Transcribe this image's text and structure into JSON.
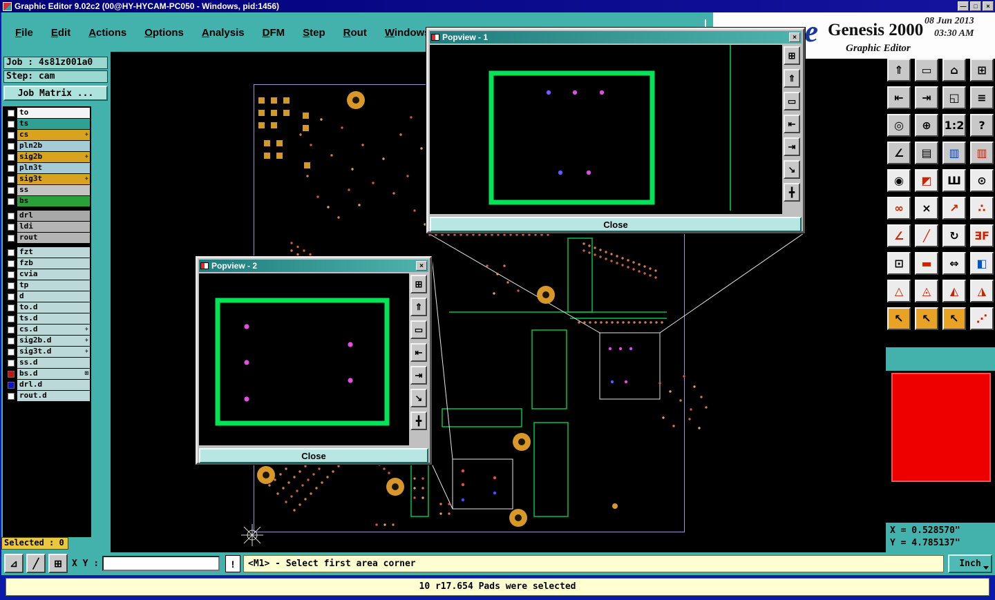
{
  "title_bar": {
    "title": "Graphic Editor 9.02c2 (00@HY-HYCAM-PC050 - Windows, pid:1456)",
    "minimize": "—",
    "maximize": "□",
    "close": "×"
  },
  "menu": {
    "items": [
      "File",
      "Edit",
      "Actions",
      "Options",
      "Analysis",
      "DFM",
      "Step",
      "Rout",
      "Windows"
    ]
  },
  "logo": {
    "partial": "ne",
    "brand": "Genesis 2000",
    "date": "08 Jun 2013",
    "time": "03:30 AM",
    "subtitle": "Graphic Editor"
  },
  "sidebar": {
    "job_label": "Job :",
    "job_value": "4s81z001a0",
    "step_label": "Step:",
    "step_value": "cam",
    "job_matrix_label": "Job Matrix ...",
    "selected_label": "Selected : 0",
    "layer_groups": {
      "main": [
        {
          "name": "to",
          "bg": "#f4f4f4"
        },
        {
          "name": "ts",
          "bg": "#2fa092"
        },
        {
          "name": "cs",
          "bg": "#d8a31e",
          "mark": "✈"
        },
        {
          "name": "pln2b",
          "bg": "#a6cbd8"
        },
        {
          "name": "sig2b",
          "bg": "#d8a31e",
          "mark": "✈"
        },
        {
          "name": "pln3t",
          "bg": "#a6cbd8"
        },
        {
          "name": "sig3t",
          "bg": "#d8a31e",
          "mark": "✈"
        },
        {
          "name": "ss",
          "bg": "#c4c4c4"
        },
        {
          "name": "bs",
          "bg": "#2ba13c"
        }
      ],
      "aux": [
        {
          "name": "drl",
          "bg": "#a8a8a8"
        },
        {
          "name": "ldi",
          "bg": "#b4b4b4"
        },
        {
          "name": "rout",
          "bg": "#b4b4b4"
        }
      ],
      "detail": [
        {
          "name": "fzt",
          "bg": "#bdd8d8"
        },
        {
          "name": "fzb",
          "bg": "#bdd8d8"
        },
        {
          "name": "cvia",
          "bg": "#bdd8d8"
        },
        {
          "name": "tp",
          "bg": "#bdd8d8"
        },
        {
          "name": "d",
          "bg": "#bdd8d8"
        },
        {
          "name": "to.d",
          "bg": "#bdd8d8"
        },
        {
          "name": "ts.d",
          "bg": "#bdd8d8"
        },
        {
          "name": "cs.d",
          "bg": "#bdd8d8",
          "mark": "✈"
        },
        {
          "name": "sig2b.d",
          "bg": "#bdd8d8",
          "mark": "✈"
        },
        {
          "name": "sig3t.d",
          "bg": "#bdd8d8",
          "mark": "✈"
        },
        {
          "name": "ss.d",
          "bg": "#bdd8d8"
        },
        {
          "name": "bs.d",
          "bg": "#bdd8d8",
          "box": "#cc1111",
          "mark": "⊞"
        },
        {
          "name": "drl.d",
          "bg": "#bdd8d8",
          "box": "#1111cc"
        },
        {
          "name": "rout.d",
          "bg": "#bdd8d8"
        }
      ]
    }
  },
  "toolbar": {
    "buttons": [
      {
        "name": "paste-up-icon",
        "glyph": "⇑"
      },
      {
        "name": "screen-icon",
        "glyph": "▭"
      },
      {
        "name": "home-icon",
        "glyph": "⌂"
      },
      {
        "name": "tile-windows-icon",
        "glyph": "⊞"
      },
      {
        "name": "dock-left-icon",
        "glyph": "⇤"
      },
      {
        "name": "dock-right-icon",
        "glyph": "⇥"
      },
      {
        "name": "zoom-window-icon",
        "glyph": "◱"
      },
      {
        "name": "layers-icon",
        "glyph": "≡"
      },
      {
        "name": "zoom-target-icon",
        "glyph": "◎"
      },
      {
        "name": "zoom-in-icon",
        "glyph": "⊕"
      },
      {
        "name": "zoom-ratio-icon",
        "glyph": "1:2"
      },
      {
        "name": "help-icon",
        "glyph": "?"
      },
      {
        "name": "measure-icon",
        "glyph": "∠"
      },
      {
        "name": "grid-icon",
        "glyph": "▤"
      },
      {
        "name": "layer-colors-blue-icon",
        "glyph": "▥",
        "fg": "#0044cc"
      },
      {
        "name": "layer-colors-red-icon",
        "glyph": "▥",
        "fg": "#cc2200"
      },
      {
        "name": "pad-icon",
        "glyph": "◉"
      },
      {
        "name": "corner-flag-icon",
        "glyph": "◩",
        "fg": "#cc2200"
      },
      {
        "name": "comb-icon",
        "glyph": "Ш"
      },
      {
        "name": "pad-ring-icon",
        "glyph": "⊙"
      },
      {
        "name": "linked-pads-icon",
        "glyph": "∞",
        "fg": "#cc2200"
      },
      {
        "name": "delete-icon",
        "glyph": "×"
      },
      {
        "name": "move-pad-icon",
        "glyph": "↗",
        "fg": "#cc2200"
      },
      {
        "name": "scatter-pads-icon",
        "glyph": "∴",
        "fg": "#cc2200"
      },
      {
        "name": "angle-icon",
        "glyph": "∠",
        "fg": "#cc2200"
      },
      {
        "name": "slope-icon",
        "glyph": "╱",
        "fg": "#cc2200"
      },
      {
        "name": "rotate-icon",
        "glyph": "↻"
      },
      {
        "name": "mirror-icon",
        "glyph": "ƎF",
        "fg": "#cc2200"
      },
      {
        "name": "origin-pad-icon",
        "glyph": "⊡"
      },
      {
        "name": "dash-icon",
        "glyph": "▬",
        "fg": "#cc2200"
      },
      {
        "name": "stretch-icon",
        "glyph": "⇔"
      },
      {
        "name": "swap-half-icon",
        "glyph": "◧",
        "fg": "#0055cc"
      },
      {
        "name": "triangle-outline-icon",
        "glyph": "△",
        "fg": "#cc2200"
      },
      {
        "name": "triangle-dot-icon",
        "glyph": "◬",
        "fg": "#cc2200"
      },
      {
        "name": "triangle-left-icon",
        "glyph": "◭",
        "fg": "#cc2200"
      },
      {
        "name": "triangle-right-icon",
        "glyph": "◮",
        "fg": "#cc2200"
      },
      {
        "name": "select-cursor-icon",
        "glyph": "↖",
        "bg": "#e8a225"
      },
      {
        "name": "select-cursor-2-icon",
        "glyph": "↖",
        "bg": "#e8a225"
      },
      {
        "name": "select-cursor-3-icon",
        "glyph": "↖",
        "bg": "#e8a225"
      },
      {
        "name": "select-dots-icon",
        "glyph": "⋰",
        "fg": "#cc2200"
      }
    ]
  },
  "popview_toolbar": {
    "buttons": [
      {
        "name": "new-window-icon",
        "glyph": "⊞"
      },
      {
        "name": "send-up-icon",
        "glyph": "⇑"
      },
      {
        "name": "screen-icon",
        "glyph": "▭"
      },
      {
        "name": "dock-left-icon",
        "glyph": "⇤"
      },
      {
        "name": "dock-right-icon",
        "glyph": "⇥"
      },
      {
        "name": "resize-icon",
        "glyph": "↘"
      },
      {
        "name": "pan-icon",
        "glyph": "╋"
      }
    ]
  },
  "popview1": {
    "title": "Popview - 1",
    "close_label": "Close"
  },
  "popview2": {
    "title": "Popview - 2",
    "close_label": "Close"
  },
  "icons": {
    "close_x": "×"
  },
  "bottom_bar": {
    "xy_label": "X Y :",
    "input_value": "",
    "bang": "!",
    "message": "<M1> - Select first area corner",
    "units": "Inch",
    "tool_buttons": [
      {
        "name": "corner-select-icon",
        "glyph": "⊿"
      },
      {
        "name": "diagonal-measure-icon",
        "glyph": "╱"
      },
      {
        "name": "grid-toggle-icon",
        "glyph": "⊞"
      }
    ]
  },
  "status_bar": {
    "text": "10 r17.654 Pads were selected"
  },
  "coords": {
    "x": "X = 0.528570\"",
    "y": "Y = 4.785137\""
  }
}
